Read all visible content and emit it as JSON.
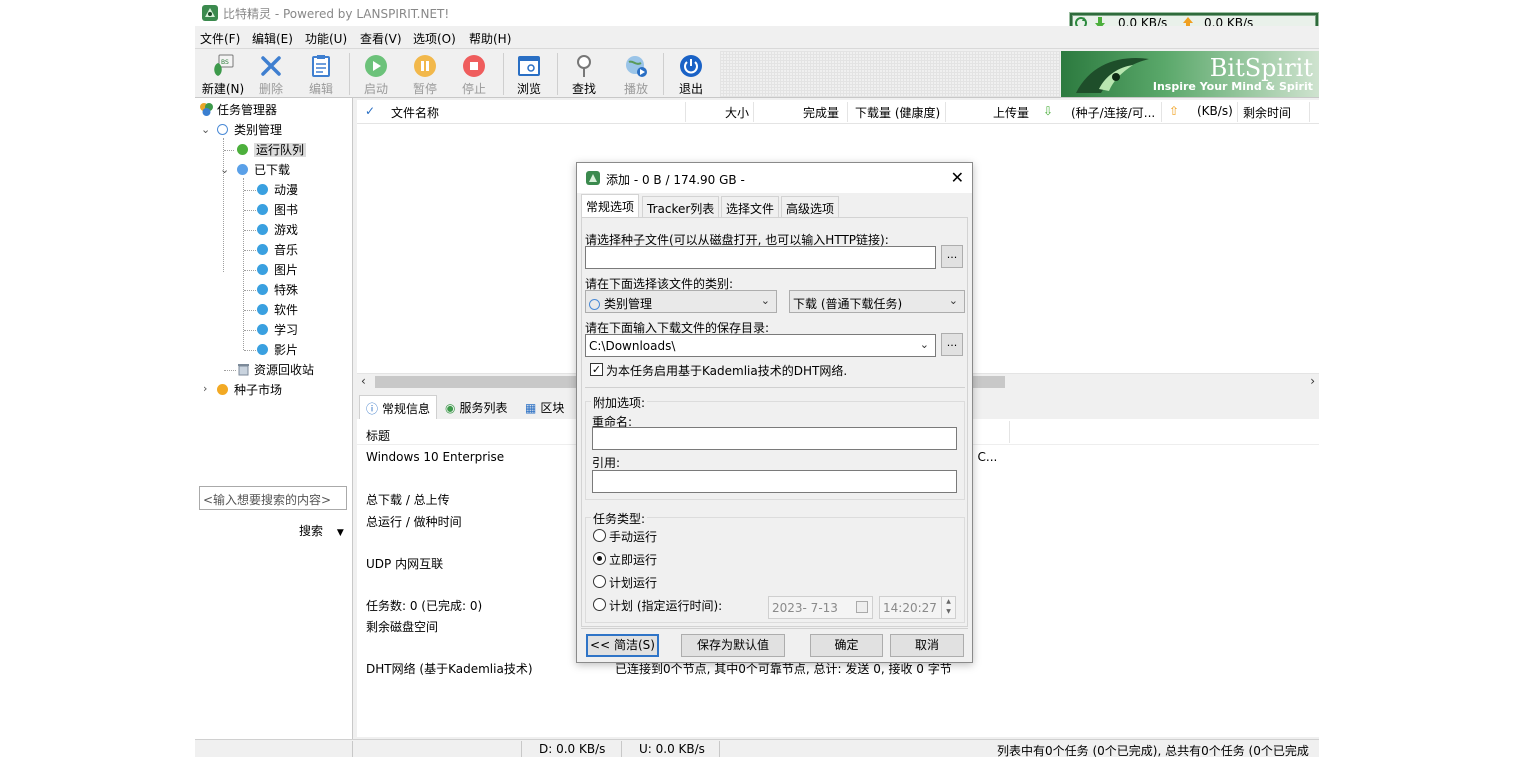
{
  "window": {
    "title": "比特精灵 - Powered by LANSPIRIT.NET!",
    "download_speed": "0.0 KB/s",
    "upload_speed": "0.0 KB/s"
  },
  "menu": [
    "文件(F)",
    "编辑(E)",
    "功能(U)",
    "查看(V)",
    "选项(O)",
    "帮助(H)"
  ],
  "toolbar": {
    "new": "新建(N)",
    "delete": "删除",
    "edit": "编辑",
    "start": "启动",
    "pause": "暂停",
    "stop": "停止",
    "browse": "浏览",
    "find": "查找",
    "play": "播放",
    "exit": "退出"
  },
  "banner": {
    "title": "BitSpirit",
    "subtitle": "Inspire Your Mind & Spirit"
  },
  "tree": {
    "root": "任务管理器",
    "category": "类别管理",
    "running": "运行队列",
    "downloaded": "已下载",
    "subcategories": [
      "动漫",
      "图书",
      "游戏",
      "音乐",
      "图片",
      "特殊",
      "软件",
      "学习",
      "影片"
    ],
    "recycle": "资源回收站",
    "market": "种子市场"
  },
  "search": {
    "placeholder": "<输入想要搜索的内容>",
    "button": "搜索"
  },
  "columns": {
    "name": "文件名称",
    "size": "大小",
    "completed": "完成量",
    "downloaded": "下载量 (健康度)",
    "uploaded": "上传量",
    "peers": "(种子/连接/可...",
    "kbs": "(KB/s)",
    "remaining": "剩余时间"
  },
  "info_tabs": [
    "常规信息",
    "服务列表",
    "区块"
  ],
  "info": {
    "title_label": "标题",
    "os": "Windows 10 Enterprise",
    "os_tail": ") C...",
    "total_dl_ul": "总下载 / 总上传",
    "total_run_seed": "总运行 / 做种时间",
    "udp": "UDP 内网互联",
    "tasks": "任务数: 0 (已完成: 0)",
    "disk": "剩余磁盘空间",
    "dht_label": "DHT网络 (基于Kademlia技术)",
    "dht_value": "已连接到0个节点, 其中0个可靠节点, 总计: 发送 0, 接收 0 字节"
  },
  "status": {
    "d": "D: 0.0 KB/s",
    "u": "U: 0.0 KB/s",
    "summary": "列表中有0个任务 (0个已完成), 总共有0个任务 (0个已完成"
  },
  "dialog": {
    "title": "添加 - 0 B / 174.90 GB -",
    "tabs": [
      "常规选项",
      "Tracker列表",
      "选择文件",
      "高级选项"
    ],
    "torrent_label": "请选择种子文件(可以从磁盘打开, 也可以输入HTTP链接):",
    "torrent_value": "",
    "browse_label": "...",
    "category_label": "请在下面选择该文件的类别:",
    "category_value": "类别管理",
    "type_value": "下载 (普通下载任务)",
    "save_label": "请在下面输入下载文件的保存目录:",
    "save_value": "C:\\Downloads\\",
    "dht_checkbox": "为本任务启用基于Kademlia技术的DHT网络.",
    "extra_group": "附加选项:",
    "rename_label": "重命名:",
    "rename_value": "",
    "quote_label": "引用:",
    "quote_value": "",
    "task_type_group": "任务类型:",
    "radio_manual": "手动运行",
    "radio_now": "立即运行",
    "radio_plan": "计划运行",
    "radio_plan_time": "计划 (指定运行时间):",
    "date": "2023-  7-13",
    "time": "14:20:27",
    "btn_simple": "<< 简洁(S)",
    "btn_save_default": "保存为默认值",
    "btn_ok": "确定",
    "btn_cancel": "取消"
  }
}
